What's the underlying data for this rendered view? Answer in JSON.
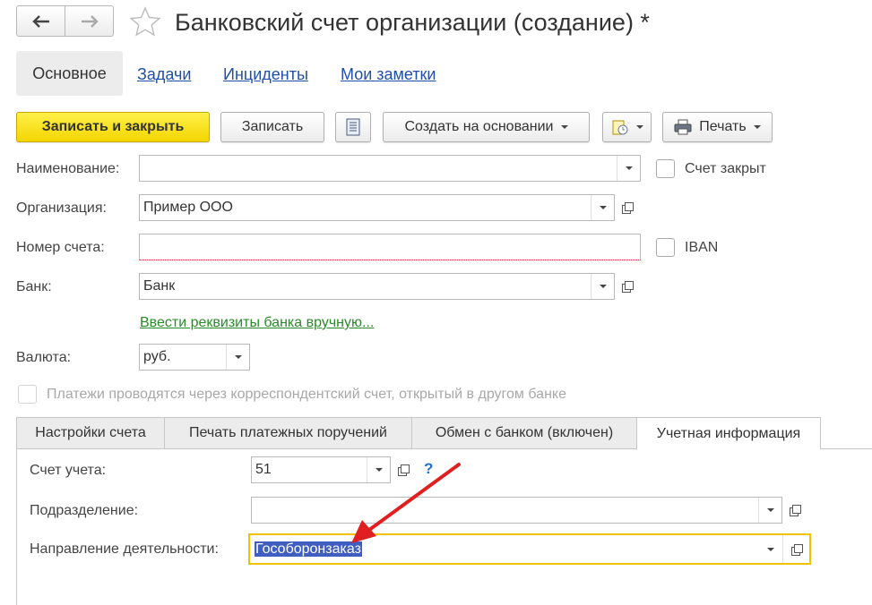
{
  "window": {
    "title": "Банковский счет организации (создание) *"
  },
  "sections": {
    "active": "Основное",
    "links": [
      "Задачи",
      "Инциденты",
      "Мои заметки"
    ]
  },
  "toolbar": {
    "save_close": "Записать и закрыть",
    "save": "Записать",
    "create_based": "Создать на основании",
    "print": "Печать"
  },
  "form": {
    "name_label": "Наименование:",
    "name_value": "",
    "closed_label": "Счет закрыт",
    "org_label": "Организация:",
    "org_value": "Пример ООО",
    "account_label": "Номер счета:",
    "account_value": "",
    "iban_label": "IBAN",
    "bank_label": "Банк:",
    "bank_value": "Банк",
    "bank_manual_link": "Ввести реквизиты банка вручную...",
    "currency_label": "Валюта:",
    "currency_value": "руб.",
    "corr_label": "Платежи проводятся через корреспондентский счет, открытый в другом банке"
  },
  "tabs": [
    {
      "label": "Настройки счета"
    },
    {
      "label": "Печать платежных поручений"
    },
    {
      "label": "Обмен с банком (включен)"
    },
    {
      "label": "Учетная информация",
      "active": true
    }
  ],
  "accounting": {
    "account_label": "Счет учета:",
    "account_value": "51",
    "help": "?",
    "division_label": "Подразделение:",
    "division_value": "",
    "activity_label": "Направление деятельности:",
    "activity_value": "Гособоронзаказ"
  },
  "colors": {
    "primary_button": "#f3d500",
    "link": "#1f4fa8",
    "green_link": "#2a8a2a",
    "focus_border": "#f2c100",
    "selection": "#3f5ec0",
    "arrow": "#e02020"
  }
}
